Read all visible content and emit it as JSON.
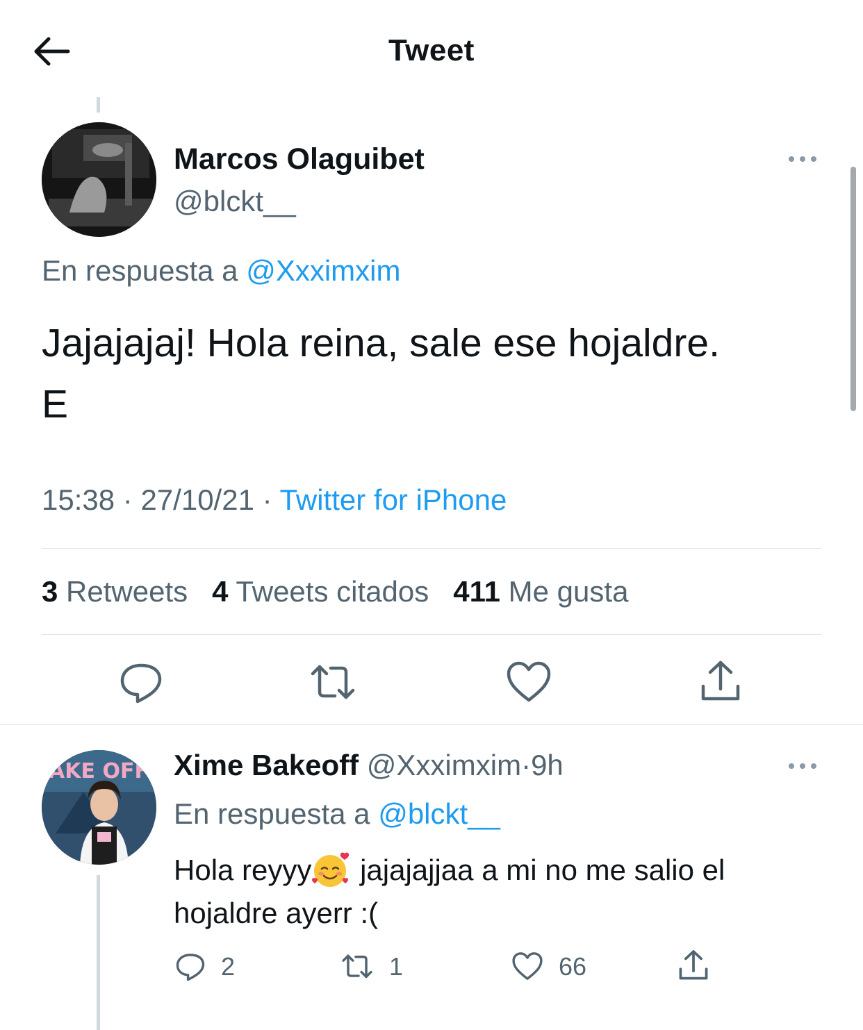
{
  "header": {
    "title": "Tweet"
  },
  "main_tweet": {
    "name": "Marcos Olaguibet",
    "handle": "@blckt__",
    "reply_prefix": "En respuesta a",
    "reply_to": "@Xxximxim",
    "text_line1": "Jajajajaj! Hola reina, sale ese hojaldre.",
    "text_line2": "E",
    "time": "15:38",
    "date": "27/10/21",
    "source": "Twitter for iPhone",
    "separator": "·",
    "stats": {
      "retweets_count": "3",
      "retweets_label": "Retweets",
      "quotes_count": "4",
      "quotes_label": "Tweets citados",
      "likes_count": "411",
      "likes_label": "Me gusta"
    }
  },
  "reply_tweet": {
    "name": "Xime Bakeoff",
    "handle": "@Xxximxim",
    "separator": "·",
    "age": "9h",
    "reply_prefix": "En respuesta a",
    "reply_to": "@blckt__",
    "text_before_emoji": "Hola reyyy",
    "emoji": "smiling-face-with-hearts",
    "text_after_emoji": " jajajajjaa a mi no me salio el hojaldre ayerr :(",
    "counts": {
      "replies": "2",
      "retweets": "1",
      "likes": "66"
    },
    "avatar_badge_text": "AKE OFF"
  },
  "colors": {
    "accent": "#1d9bf0",
    "secondary_text": "#536471",
    "primary_text": "#0f1419",
    "divider": "#dfe4e7"
  }
}
